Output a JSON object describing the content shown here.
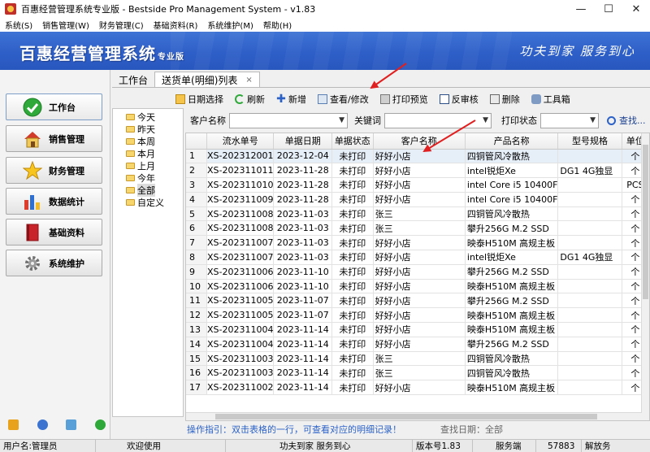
{
  "window": {
    "title": "百惠经营管理系统专业版 - Bestside Pro Management System - v1.83",
    "controls": [
      "—",
      "☐",
      "✕"
    ]
  },
  "menu": [
    "系统(S)",
    "销售管理(W)",
    "财务管理(C)",
    "基础资料(R)",
    "系统维护(M)",
    "帮助(H)"
  ],
  "banner": {
    "logo": "百惠经营管理系统",
    "edition": "专业版",
    "slogan": "功夫到家  服务到心"
  },
  "sidebar": {
    "items": [
      {
        "label": "工作台",
        "icon": "check-icon"
      },
      {
        "label": "销售管理",
        "icon": "house-icon"
      },
      {
        "label": "财务管理",
        "icon": "star-icon"
      },
      {
        "label": "数据统计",
        "icon": "bar-chart-icon"
      },
      {
        "label": "基础资料",
        "icon": "book-icon"
      },
      {
        "label": "系统维护",
        "icon": "gear-icon"
      }
    ]
  },
  "tabs": [
    {
      "label": "工作台"
    },
    {
      "label": "送货单(明细)列表",
      "close": "×"
    }
  ],
  "toolbar": [
    "日期选择",
    "刷新",
    "新增",
    "查看/修改",
    "打印预览",
    "反审核",
    "删除",
    "工具箱"
  ],
  "date_tree": [
    "今天",
    "昨天",
    "本周",
    "本月",
    "上月",
    "今年",
    "全部",
    "自定义"
  ],
  "filters": {
    "customer_label": "客户名称",
    "keyword_label": "关键词",
    "print_status_label": "打印状态",
    "search_label": "查找..."
  },
  "grid": {
    "columns": [
      "流水单号",
      "单据日期",
      "单据状态",
      "客户名称",
      "产品名称",
      "型号规格",
      "单位"
    ],
    "rows": [
      [
        "1",
        "XS-202312001",
        "2023-12-04",
        "未打印",
        "好好小店",
        "四铜管风冷散热",
        "",
        "个"
      ],
      [
        "2",
        "XS-202311011",
        "2023-11-28",
        "未打印",
        "好好小店",
        "intel锐炬Xe",
        "DG1 4G独显",
        "个"
      ],
      [
        "3",
        "XS-202311010",
        "2023-11-28",
        "未打印",
        "好好小店",
        "intel Core i5 10400F",
        "",
        "PCS"
      ],
      [
        "4",
        "XS-202311009",
        "2023-11-28",
        "未打印",
        "好好小店",
        "intel Core i5 10400F",
        "",
        "个"
      ],
      [
        "5",
        "XS-202311008",
        "2023-11-03",
        "未打印",
        "张三",
        "四铜管风冷散热",
        "",
        "个"
      ],
      [
        "6",
        "XS-202311008",
        "2023-11-03",
        "未打印",
        "张三",
        "攀升256G M.2 SSD",
        "",
        "个"
      ],
      [
        "7",
        "XS-202311007",
        "2023-11-03",
        "未打印",
        "好好小店",
        "映泰H510M 高规主板",
        "",
        "个"
      ],
      [
        "8",
        "XS-202311007",
        "2023-11-03",
        "未打印",
        "好好小店",
        "intel锐炬Xe",
        "DG1 4G独显",
        "个"
      ],
      [
        "9",
        "XS-202311006",
        "2023-11-10",
        "未打印",
        "好好小店",
        "攀升256G M.2 SSD",
        "",
        "个"
      ],
      [
        "10",
        "XS-202311006",
        "2023-11-10",
        "未打印",
        "好好小店",
        "映泰H510M 高规主板",
        "",
        "个"
      ],
      [
        "11",
        "XS-202311005",
        "2023-11-07",
        "未打印",
        "好好小店",
        "攀升256G M.2 SSD",
        "",
        "个"
      ],
      [
        "12",
        "XS-202311005",
        "2023-11-07",
        "未打印",
        "好好小店",
        "映泰H510M 高规主板",
        "",
        "个"
      ],
      [
        "13",
        "XS-202311004",
        "2023-11-14",
        "未打印",
        "好好小店",
        "映泰H510M 高规主板",
        "",
        "个"
      ],
      [
        "14",
        "XS-202311004",
        "2023-11-14",
        "未打印",
        "好好小店",
        "攀升256G M.2 SSD",
        "",
        "个"
      ],
      [
        "15",
        "XS-202311003",
        "2023-11-14",
        "未打印",
        "张三",
        "四铜管风冷散热",
        "",
        "个"
      ],
      [
        "16",
        "XS-202311003",
        "2023-11-14",
        "未打印",
        "张三",
        "四铜管风冷散热",
        "",
        "个"
      ],
      [
        "17",
        "XS-202311002",
        "2023-11-14",
        "未打印",
        "好好小店",
        "映泰H510M 高规主板",
        "",
        "个"
      ]
    ]
  },
  "hint": "操作指引：双击表格的一行，可查看对应的明细记录！",
  "query_date": "查找日期：全部",
  "status": {
    "user": "用户名:管理员",
    "welcome": "欢迎使用",
    "slogan": "功夫到家 服务到心",
    "version": "版本号1.83",
    "service": "服务端",
    "port": "57883",
    "unlock": "解放务"
  },
  "colors": {
    "banner": "#2e5fc8",
    "hint": "#2c62c8",
    "selected_row": "#e6eef8",
    "arrow": "#e02020"
  }
}
